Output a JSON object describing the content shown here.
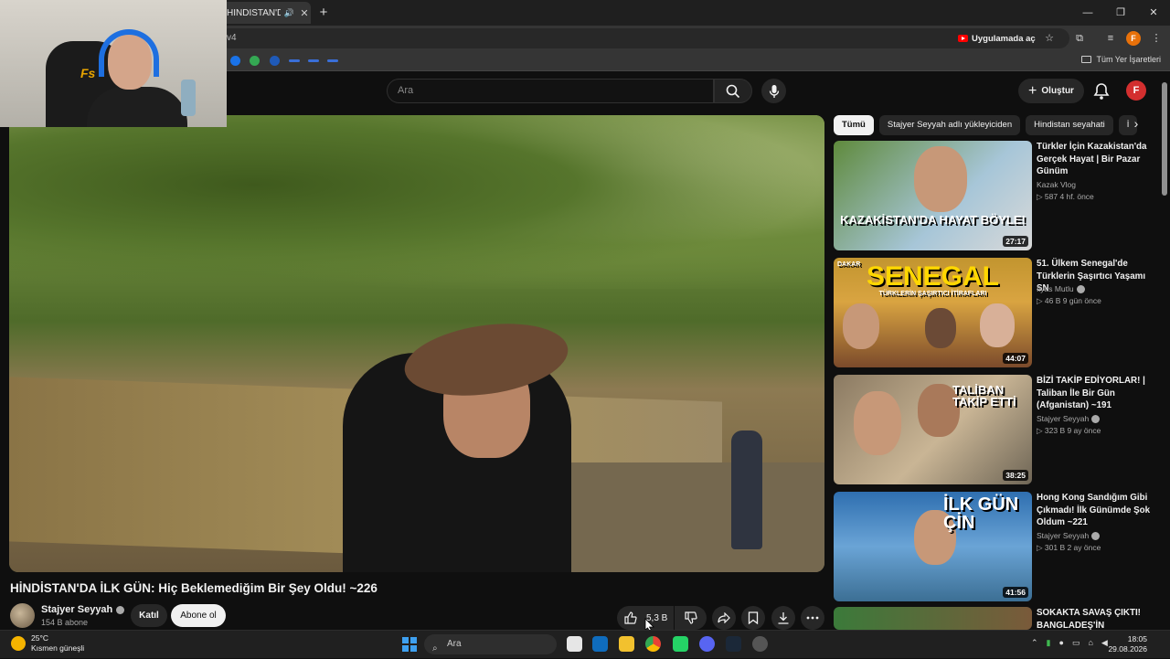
{
  "browser": {
    "tab_title": "HİNDİSTAN'DA İLK GÜN: Hi",
    "address": "v4",
    "open_in_app": "Uygulamada aç",
    "profile_letter": "F",
    "bookmarks_all": "Tüm Yer İşaretleri",
    "window_controls": [
      "—",
      "❐",
      "✕"
    ]
  },
  "youtube": {
    "search_placeholder": "Ara",
    "create_label": "Oluştur",
    "avatar_letter": "F"
  },
  "video": {
    "title": "HİNDİSTAN'DA İLK GÜN: Hiç Beklemediğim Bir Şey Oldu! ~226",
    "channel": "Stajyer Seyyah",
    "subscribers": "154 B abone",
    "join_label": "Katıl",
    "subscribe_label": "Abone ol",
    "likes": "5,3 B"
  },
  "sidebar": {
    "chips": [
      "Tümü",
      "Stajyer Seyyah adlı yükleyiciden",
      "Hindistan seyahati",
      "İ"
    ],
    "recommendations": [
      {
        "title": "Türkler İçin Kazakistan'da Gerçek Hayat | Bir Pazar Günüm",
        "channel": "Kazak Vlog",
        "meta": "▷ 587   4 hf. önce",
        "duration": "27:17",
        "overlay": "KAZAKİSTAN'DA HAYAT BÖYLE!"
      },
      {
        "title": "51. Ülkem Senegal'de Türklerin Şaşırtıcı Yaşamı SN",
        "channel": "İlyas Mutlu",
        "meta": "▷ 46 B   9 gün önce",
        "duration": "44:07",
        "overlay": "SENEGAL",
        "overlay2": "TÜRKLERİN ŞAŞIRTICI İTİRAFLARI",
        "overlay3": "DAKAR"
      },
      {
        "title": "BİZİ TAKİP EDİYORLAR! | Taliban İle Bir Gün (Afganistan) ~191",
        "channel": "Stajyer Seyyah",
        "meta": "▷ 323 B   9 ay önce",
        "duration": "38:25",
        "overlay": "TALİBAN TAKİP ETTİ"
      },
      {
        "title": "Hong Kong Sandığım Gibi Çıkmadı! İlk Günümde Şok Oldum ~221",
        "channel": "Stajyer Seyyah",
        "meta": "▷ 301 B   2 ay önce",
        "duration": "41:56",
        "overlay": "İLK GÜN ÇİN"
      },
      {
        "title": "SOKAKTA SAVAŞ ÇIKTI! BANGLADEŞ'İN",
        "channel": "",
        "meta": "",
        "duration": "",
        "overlay": ""
      }
    ]
  },
  "taskbar": {
    "temperature": "25°C",
    "weather": "Kısmen güneşli",
    "search": "Ara",
    "time": "18:05",
    "date": "29.08.2026"
  },
  "webcam": {
    "logo": "Fs"
  },
  "colors": {
    "youtube_red": "#ff0000",
    "avatar": "#d32f2f",
    "profile": "#e8710a"
  }
}
